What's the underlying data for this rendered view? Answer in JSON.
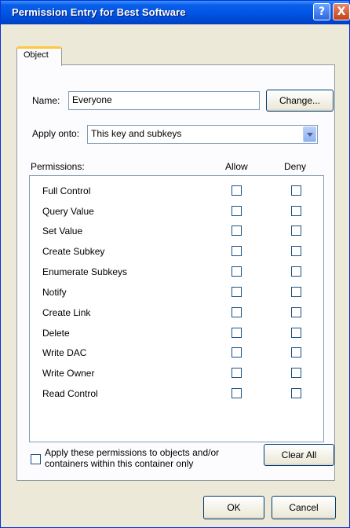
{
  "window": {
    "title": "Permission Entry for Best Software",
    "help_glyph": "?",
    "close_glyph": "X"
  },
  "tab": {
    "label": "Object"
  },
  "name": {
    "label": "Name:",
    "value": "Everyone",
    "change_button": "Change..."
  },
  "apply_onto": {
    "label": "Apply onto:",
    "value": "This key and subkeys"
  },
  "permissions": {
    "header": "Permissions:",
    "allow_header": "Allow",
    "deny_header": "Deny",
    "items": [
      {
        "label": "Full Control",
        "allow": false,
        "deny": false
      },
      {
        "label": "Query Value",
        "allow": false,
        "deny": false
      },
      {
        "label": "Set Value",
        "allow": false,
        "deny": false
      },
      {
        "label": "Create Subkey",
        "allow": false,
        "deny": false
      },
      {
        "label": "Enumerate Subkeys",
        "allow": false,
        "deny": false
      },
      {
        "label": "Notify",
        "allow": false,
        "deny": false
      },
      {
        "label": "Create Link",
        "allow": false,
        "deny": false
      },
      {
        "label": "Delete",
        "allow": false,
        "deny": false
      },
      {
        "label": "Write DAC",
        "allow": false,
        "deny": false
      },
      {
        "label": "Write Owner",
        "allow": false,
        "deny": false
      },
      {
        "label": "Read Control",
        "allow": false,
        "deny": false
      }
    ]
  },
  "apply_inherit": {
    "line1": "Apply these permissions to objects and/or",
    "line2": "containers within this container only",
    "checked": false
  },
  "clear_all_button": "Clear All",
  "ok_button": "OK",
  "cancel_button": "Cancel",
  "colors": {
    "title_bar": "#0055e5",
    "dialog_bg": "#ece9d8",
    "tab_highlight": "#ffc83c"
  }
}
